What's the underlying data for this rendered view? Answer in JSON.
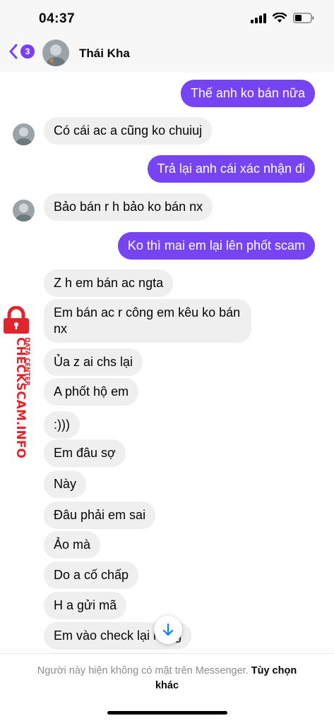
{
  "status_bar": {
    "time": "04:37"
  },
  "header": {
    "back_badge": "3",
    "contact_name": "Thái Kha"
  },
  "colors": {
    "accent": "#7644f2",
    "incoming_bubble": "#efefef",
    "watermark": "#e0262c"
  },
  "watermark": {
    "brand": "CHECKSCAM.INFO",
    "tagline": "DATA CENTER"
  },
  "messages": [
    {
      "dir": "out",
      "text": "Thế anh ko bán nữa"
    },
    {
      "dir": "in",
      "text": "Có cái ac a cũng ko chuiuj"
    },
    {
      "dir": "out",
      "text": "Trả lại anh cái xác nhận đi"
    },
    {
      "dir": "in",
      "text": "Bảo bán r h bảo ko bán nx"
    },
    {
      "dir": "out",
      "text": "Ko thì mai em lại lên phốt scam"
    },
    {
      "dir": "in",
      "text": "Z h em bán ac ngta"
    },
    {
      "dir": "in",
      "text": "Em bán ac r công em kêu ko bán nx"
    },
    {
      "dir": "in",
      "text": "Ủa z ai chs lại"
    },
    {
      "dir": "in",
      "text": "A phốt hộ em"
    },
    {
      "dir": "in",
      "text": ":)))"
    },
    {
      "dir": "in",
      "text": "Em đâu sợ"
    },
    {
      "dir": "in",
      "text": "Này"
    },
    {
      "dir": "in",
      "text": "Đâu phải em sai"
    },
    {
      "dir": "in",
      "text": "Ảo mà"
    },
    {
      "dir": "in",
      "text": "Do a cố chấp"
    },
    {
      "dir": "in",
      "text": "H a gửi mã"
    },
    {
      "dir": "in",
      "text": "Em vào check lại hàng"
    }
  ],
  "footer": {
    "notice": "Người này hiện không có mặt trên Messenger.",
    "link": "Tùy chọn khác"
  }
}
